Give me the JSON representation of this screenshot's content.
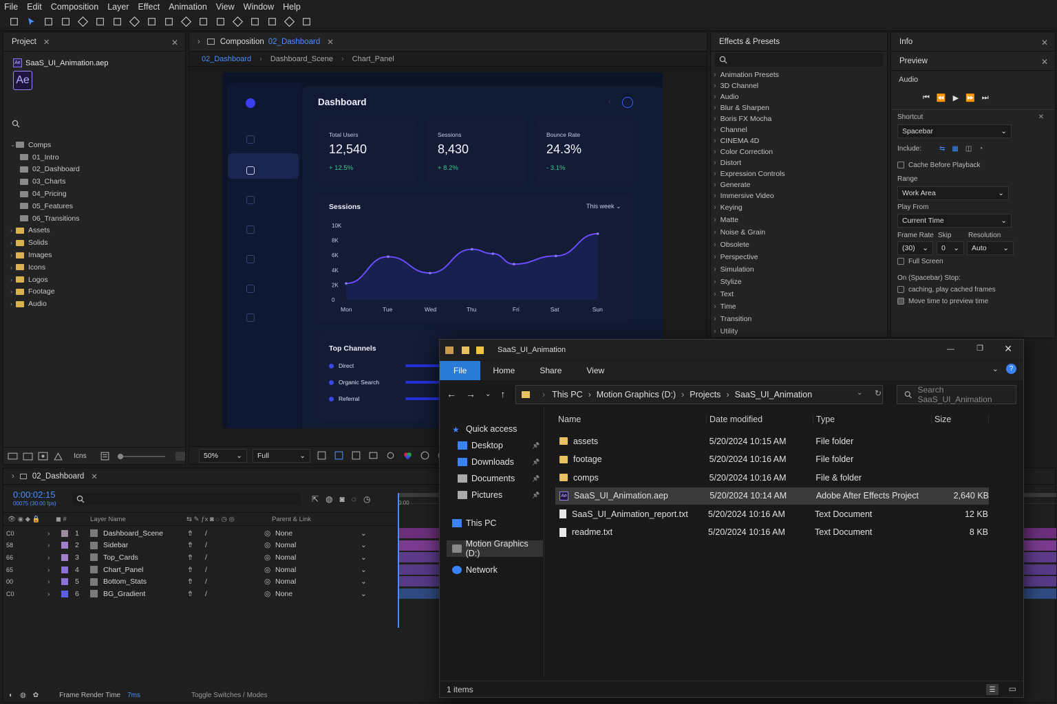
{
  "menu": [
    "File",
    "Edit",
    "Composition",
    "Layer",
    "Effect",
    "Animation",
    "View",
    "Window",
    "Help"
  ],
  "project": {
    "tab": "Project",
    "file": "SaaS_UI_Animation.aep",
    "logo": "Ae",
    "search": "",
    "tree": [
      {
        "label": "Comps",
        "type": "folder",
        "open": true
      },
      {
        "label": "01_Intro",
        "type": "comp"
      },
      {
        "label": "02_Dashboard",
        "type": "comp"
      },
      {
        "label": "03_Charts",
        "type": "comp"
      },
      {
        "label": "04_Pricing",
        "type": "comp"
      },
      {
        "label": "05_Features",
        "type": "comp"
      },
      {
        "label": "06_Transitions",
        "type": "comp"
      },
      {
        "label": "Assets",
        "type": "folder"
      },
      {
        "label": "Solids",
        "type": "folder"
      },
      {
        "label": "Images",
        "type": "folder"
      },
      {
        "label": "Icons",
        "type": "folder"
      },
      {
        "label": "Logos",
        "type": "folder"
      },
      {
        "label": "Footage",
        "type": "folder"
      },
      {
        "label": "Audio",
        "type": "folder"
      }
    ],
    "bottom_label": "Icns"
  },
  "comp": {
    "tab_prefix": "Composition",
    "tab_name": "02_Dashboard",
    "crumbs": [
      "02_Dashboard",
      "Dashboard_Scene",
      "Chart_Panel"
    ],
    "zoom": "50%",
    "quality": "Full"
  },
  "dash": {
    "title": "Dashboard",
    "stats": [
      {
        "label": "Total Users",
        "value": "12,540",
        "delta": "+ 12.5%"
      },
      {
        "label": "Sessions",
        "value": "8,430",
        "delta": "+ 8.2%"
      },
      {
        "label": "Bounce Rate",
        "value": "24.3%",
        "delta": "- 3.1%"
      }
    ],
    "sessions_title": "Sessions",
    "range": "This week",
    "channels_title": "Top Channels",
    "channels": [
      "Direct",
      "Organic Search",
      "Referral"
    ]
  },
  "chart_data": {
    "type": "line",
    "title": "Sessions",
    "categories": [
      "Mon",
      "Tue",
      "Wed",
      "Thu",
      "Fri",
      "Sat",
      "Sun"
    ],
    "yticks": [
      "10K",
      "8K",
      "6K",
      "4K",
      "2K",
      "0"
    ],
    "ylim": [
      0,
      10000
    ],
    "x": [
      0,
      1,
      2,
      3,
      3.5,
      4,
      5,
      6
    ],
    "values": [
      2200,
      5800,
      3600,
      6800,
      6200,
      4800,
      5900,
      8900
    ],
    "grid": false,
    "colors": [
      "#6a4cff"
    ]
  },
  "effects": {
    "tab": "Effects & Presets",
    "search": "",
    "items": [
      "Animation Presets",
      "3D Channel",
      "Audio",
      "Blur & Sharpen",
      "Boris FX Mocha",
      "Channel",
      "CINEMA 4D",
      "Color Correction",
      "Distort",
      "Expression Controls",
      "Generate",
      "Immersive Video",
      "Keying",
      "Matte",
      "Noise & Grain",
      "Obsolete",
      "Perspective",
      "Simulation",
      "Stylize",
      "Text",
      "Time",
      "Transition",
      "Utility"
    ]
  },
  "info": {
    "info_tab": "Info",
    "preview_tab": "Preview",
    "audio": "Audio",
    "shortcut_label": "Shortcut",
    "shortcut": "Spacebar",
    "include": "Include:",
    "cache": "Cache Before Playback",
    "range_label": "Range",
    "range": "Work Area",
    "play_from_label": "Play From",
    "play_from": "Current Time",
    "fr_label": "Frame Rate",
    "skip_label": "Skip",
    "res_label": "Resolution",
    "fr": "(30)",
    "skip": "0",
    "res": "Auto",
    "fullscreen": "Full Screen",
    "stop_label": "On (Spacebar) Stop:",
    "opt1": "caching, play cached frames",
    "opt2": "Move time to preview time"
  },
  "timeline": {
    "tab": "02_Dashboard",
    "time": "0:00:02:15",
    "fps": "00075 (30.00 fps)",
    "search": "",
    "col_layer": "Layer Name",
    "col_parent": "Parent & Link",
    "ruler_start": "0:00",
    "layers": [
      {
        "lock": "C0",
        "num": "1",
        "name": "Dashboard_Scene",
        "parent": "None",
        "color": "#9a8c9a",
        "bar": "#6b2f7a"
      },
      {
        "lock": "58",
        "num": "2",
        "name": "Sidebar",
        "parent": "Nomal",
        "color": "#a080c8",
        "bar": "#7a3a8e"
      },
      {
        "lock": "66",
        "num": "3",
        "name": "Top_Cards",
        "parent": "Nomal",
        "color": "#a080c8",
        "bar": "#5e3a8a"
      },
      {
        "lock": "65",
        "num": "4",
        "name": "Chart_Panel",
        "parent": "Nomal",
        "color": "#8a70d8",
        "bar": "#563a86"
      },
      {
        "lock": "00",
        "num": "5",
        "name": "Bottom_Stats",
        "parent": "Nomal",
        "color": "#8a70d8",
        "bar": "#563a86"
      },
      {
        "lock": "C0",
        "num": "6",
        "name": "BG_Gradient",
        "parent": "None",
        "color": "#5a60e8",
        "bar": "#2f4a80"
      }
    ],
    "render_label": "Frame Render Time",
    "render_value": "7ms",
    "toggle": "Toggle Switches / Modes"
  },
  "explorer": {
    "title": "SaaS_UI_Animation",
    "ribbon": [
      "File",
      "Home",
      "Share",
      "View"
    ],
    "path": [
      "This PC",
      "Motion Graphics (D:)",
      "Projects",
      "SaaS_UI_Animation"
    ],
    "search_placeholder": "Search SaaS_UI_Animation",
    "nav": {
      "quick": "Quick access",
      "pinned": [
        "Desktop",
        "Downloads",
        "Documents",
        "Pictures"
      ],
      "thispc": "This PC",
      "drive": "Motion Graphics (D:)",
      "network": "Network"
    },
    "cols": [
      "Name",
      "Date modified",
      "Type",
      "Size"
    ],
    "files": [
      {
        "name": "assets",
        "date": "5/20/2024 10:15 AM",
        "type": "File folder",
        "size": "",
        "kind": "folder"
      },
      {
        "name": "footage",
        "date": "5/20/2024 10:16 AM",
        "type": "File folder",
        "size": "",
        "kind": "folder"
      },
      {
        "name": "comps",
        "date": "5/20/2024 10:16 AM",
        "type": "File & folder",
        "size": "",
        "kind": "folder"
      },
      {
        "name": "SaaS_UI_Animation.aep",
        "date": "5/20/2024 10:14 AM",
        "type": "Adobe After Effects Project",
        "size": "2,640 KB",
        "kind": "aep",
        "selected": true
      },
      {
        "name": "SaaS_UI_Animation_report.txt",
        "date": "5/20/2024 10:16 AM",
        "type": "Text Document",
        "size": "12 KB",
        "kind": "txt"
      },
      {
        "name": "readme.txt",
        "date": "5/20/2024 10:16 AM",
        "type": "Text Document",
        "size": "8 KB",
        "kind": "txt"
      }
    ],
    "status": "1 items"
  }
}
